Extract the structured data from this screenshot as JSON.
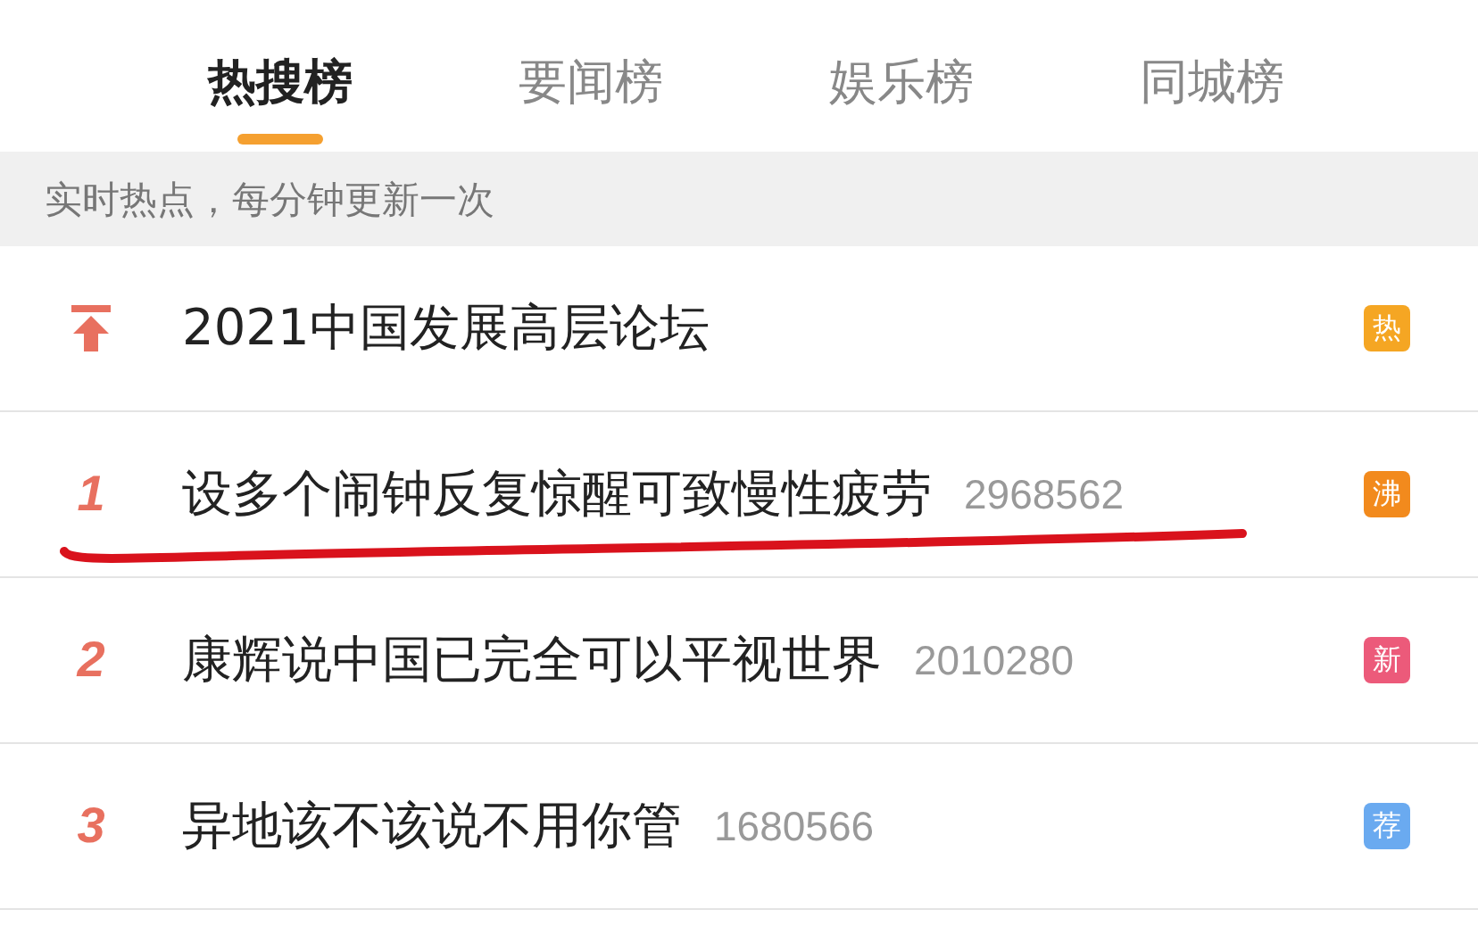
{
  "tabs": [
    {
      "label": "热搜榜",
      "selected": true
    },
    {
      "label": "要闻榜",
      "selected": false
    },
    {
      "label": "娱乐榜",
      "selected": false
    },
    {
      "label": "同城榜",
      "selected": false
    }
  ],
  "notice": "实时热点，每分钟更新一次",
  "rows": [
    {
      "kind": "pinned",
      "title": "2021中国发展高层论坛",
      "badge": "热",
      "color": "#f5a623",
      "underlined": false
    },
    {
      "kind": "ranked",
      "rank": "1",
      "title": "设多个闹钟反复惊醒可致慢性疲劳",
      "count": "2968562",
      "badge": "沸",
      "color": "#f28a1d",
      "underlined": true
    },
    {
      "kind": "ranked",
      "rank": "2",
      "title": "康辉说中国已完全可以平视世界",
      "count": "2010280",
      "badge": "新",
      "color": "#ec5a7a",
      "underlined": false
    },
    {
      "kind": "ranked",
      "rank": "3",
      "title": "异地该不该说不用你管",
      "count": "1680566",
      "badge": "荐",
      "color": "#6aaaf0",
      "underlined": false
    }
  ]
}
